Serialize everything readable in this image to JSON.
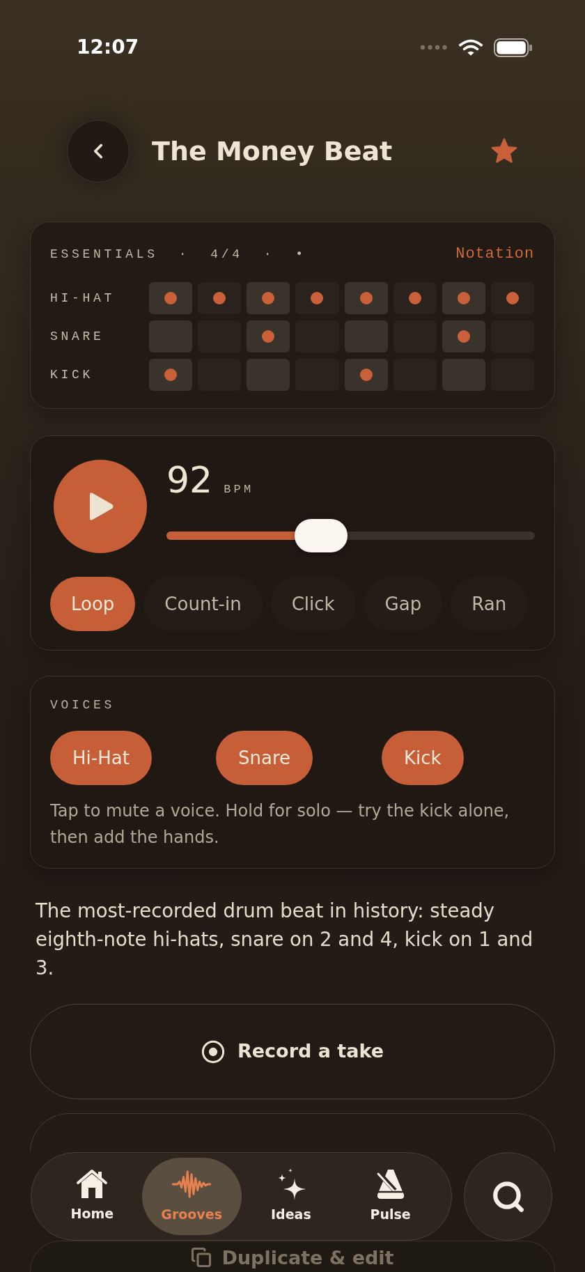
{
  "status_bar": {
    "time": "12:07"
  },
  "header": {
    "title": "The Money Beat",
    "favorite": true
  },
  "pattern": {
    "meta": [
      "ESSENTIALS",
      "·",
      "4/4",
      "·",
      "•"
    ],
    "notation_link": "Notation",
    "rows": [
      {
        "label": "HI-HAT",
        "steps": [
          {
            "on": true
          },
          {
            "on": true
          },
          {
            "on": true
          },
          {
            "on": true
          },
          {
            "on": true
          },
          {
            "on": true
          },
          {
            "on": true
          },
          {
            "on": true
          }
        ]
      },
      {
        "label": "SNARE",
        "steps": [
          {
            "on": false
          },
          {
            "on": false
          },
          {
            "on": true
          },
          {
            "on": false
          },
          {
            "on": false
          },
          {
            "on": false
          },
          {
            "on": true
          },
          {
            "on": false
          }
        ]
      },
      {
        "label": "KICK",
        "steps": [
          {
            "on": true
          },
          {
            "on": false
          },
          {
            "on": false
          },
          {
            "on": false
          },
          {
            "on": true
          },
          {
            "on": false
          },
          {
            "on": false
          },
          {
            "on": false
          }
        ]
      }
    ]
  },
  "tempo": {
    "bpm": "92",
    "unit": "BPM",
    "playing": false,
    "slider": {
      "level": 0.42
    },
    "options": [
      {
        "label": "Loop",
        "selected": true
      },
      {
        "label": "Count-in",
        "selected": false
      },
      {
        "label": "Click",
        "selected": false
      },
      {
        "label": "Gap",
        "selected": false
      },
      {
        "label": "Ran",
        "selected": false
      }
    ]
  },
  "voices": {
    "heading": "VOICES",
    "items": [
      {
        "label": "Hi-Hat",
        "muted": false
      },
      {
        "label": "Snare",
        "muted": false
      },
      {
        "label": "Kick",
        "muted": false
      }
    ],
    "hint": "Tap to mute a voice. Hold for solo — try the kick alone, then add the hands."
  },
  "description": "The most-recorded drum beat in history: steady eighth-note hi-hats, snare on 2 and 4, kick on 1 and 3.",
  "actions": [
    {
      "kind": "record",
      "label": "Record a take"
    },
    {
      "kind": "covered"
    }
  ],
  "tab_bar": {
    "items": [
      {
        "label": "Home",
        "selected": false
      },
      {
        "label": "Grooves",
        "selected": true
      },
      {
        "label": "Ideas",
        "selected": false
      },
      {
        "label": "Pulse",
        "selected": false
      }
    ]
  },
  "below_tab_bar": {
    "kind": "duplicate",
    "label": "Duplicate & edit"
  }
}
